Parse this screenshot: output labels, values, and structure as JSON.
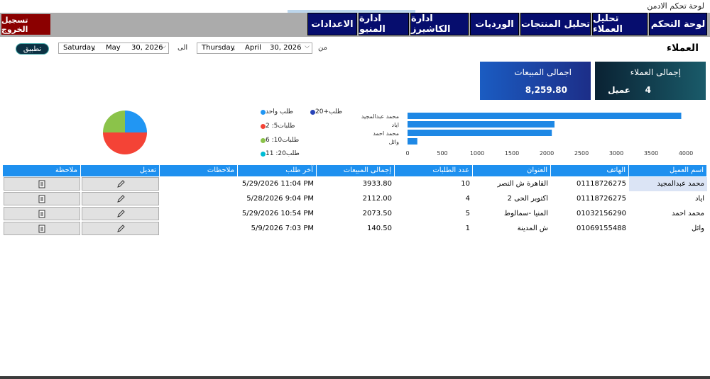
{
  "window": {
    "title": "لوحة تحكم الادمن"
  },
  "nav": {
    "items": [
      "لوحة التحكم",
      "تحليل العملاء",
      "تحليل المنتجات",
      "الورديات",
      "ادارة الكاشيرز",
      "ادارة المنيو",
      "الاعدادات"
    ],
    "logout": "تسجيل الخروج"
  },
  "filter": {
    "apply": "تطبيق",
    "to_label": "الى",
    "from_label": "من",
    "to_date": {
      "day": "Saturday",
      "month": "May",
      "date": "30, 2026"
    },
    "from_date": {
      "day": "Thursday",
      "month": "April",
      "date": "30, 2026"
    }
  },
  "page": {
    "title": "العملاء"
  },
  "cards": {
    "customers": {
      "title": "إجمالى العملاء",
      "value": "4",
      "unit": "عميل",
      "color": "#0f3f53"
    },
    "sales": {
      "title": "اجمالى المبيعات",
      "value": "8,259.80",
      "color": "#1a3ca0"
    }
  },
  "pie": {
    "legend": [
      {
        "label": "طلب واحد",
        "color": "#2196f3"
      },
      {
        "label": "20+طلب",
        "color": "#2944b8"
      },
      {
        "label": "2 :5طلبات",
        "color": "#f44336"
      },
      {
        "label": "6 :10طلبات",
        "color": "#8bc34a"
      },
      {
        "label": "11 :20طلب",
        "color": "#00bcd4"
      }
    ],
    "slices": [
      {
        "name": "one",
        "value": 1,
        "color": "#2196f3"
      },
      {
        "name": "two_five",
        "value": 2,
        "color": "#f44336"
      },
      {
        "name": "six_ten",
        "value": 1,
        "color": "#8bc34a"
      }
    ]
  },
  "chart_data": {
    "type": "bar",
    "orientation": "horizontal",
    "categories": [
      "محمد عبدالمجيد",
      "اياد",
      "محمد احمد",
      "وائل"
    ],
    "values": [
      3933.8,
      2112.0,
      2073.5,
      140.5
    ],
    "xlim": [
      0,
      4000
    ],
    "xticks": [
      "0",
      "500",
      "1000",
      "1500",
      "2000",
      "2500",
      "3000",
      "3500",
      "4000"
    ],
    "color": "#1e88e5"
  },
  "table": {
    "headers": [
      "اسم العميل",
      "الهاتف",
      "العنوان",
      "عدد الطلبات",
      "إجمالى المبيعات",
      "آخر طلب",
      "ملاحظات",
      "تعديل",
      "ملاحظة"
    ],
    "rows": [
      [
        "محمد عبدالمجيد",
        "01118726275",
        "القاهرة ش النصر",
        "10",
        "3933.80",
        "5/29/2026 11:04 PM",
        ""
      ],
      [
        "اياد",
        "01118726275",
        "اكتوبر الحى 2",
        "4",
        "2112.00",
        "5/28/2026 9:04 PM",
        ""
      ],
      [
        "محمد احمد",
        "01032156290",
        "المنيا -سمالوط",
        "5",
        "2073.50",
        "5/29/2026 10:54 PM",
        ""
      ],
      [
        "وائل",
        "01069155488",
        "ش المدينة",
        "1",
        "140.50",
        "5/9/2026 7:03 PM",
        ""
      ]
    ]
  }
}
